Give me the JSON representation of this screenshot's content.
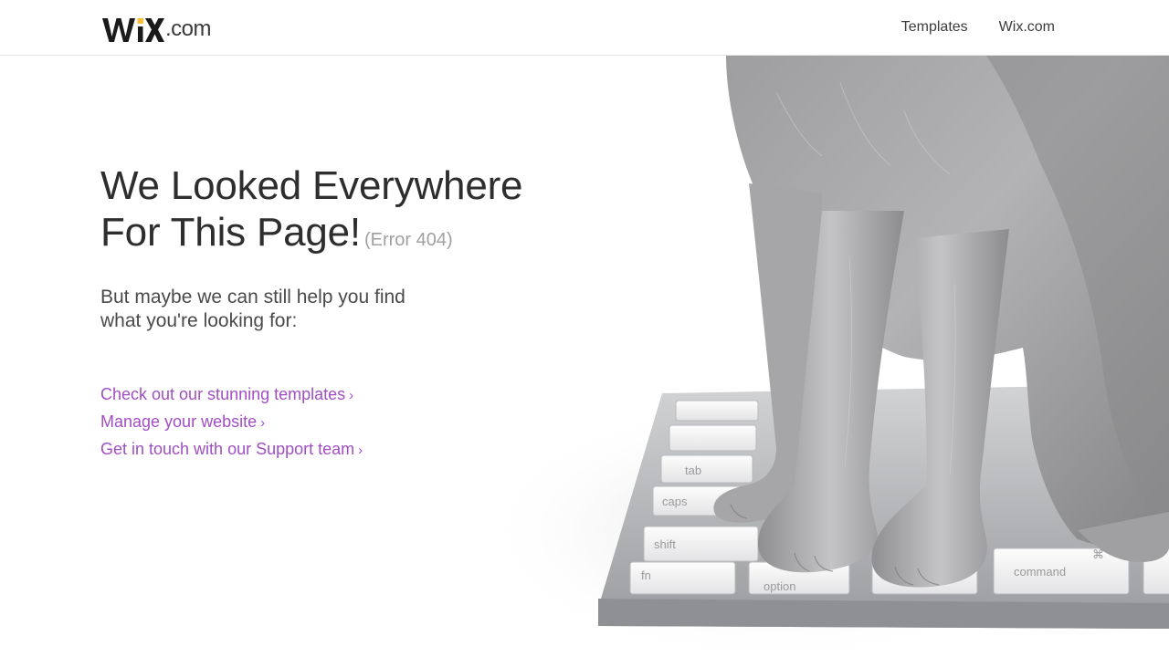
{
  "header": {
    "logo_suffix": ".com",
    "nav": [
      {
        "label": "Templates"
      },
      {
        "label": "Wix.com"
      }
    ]
  },
  "main": {
    "title_line1": "We Looked Everywhere",
    "title_line2": "For This Page!",
    "error_code": "(Error 404)",
    "subtitle": "But maybe we can still help you find what you're looking for:",
    "links": [
      {
        "label": "Check out our stunning templates"
      },
      {
        "label": "Manage your website"
      },
      {
        "label": "Get in touch with our Support team"
      }
    ],
    "chevron": "›"
  },
  "keyboard": {
    "keys": [
      "tab",
      "caps",
      "shift",
      "fn",
      "option",
      "command",
      "⌘"
    ]
  },
  "colors": {
    "link": "#a14ec4",
    "title": "#2e2e2e",
    "error_code": "#a0a0a0",
    "logo_dot": "#fbbd33"
  }
}
